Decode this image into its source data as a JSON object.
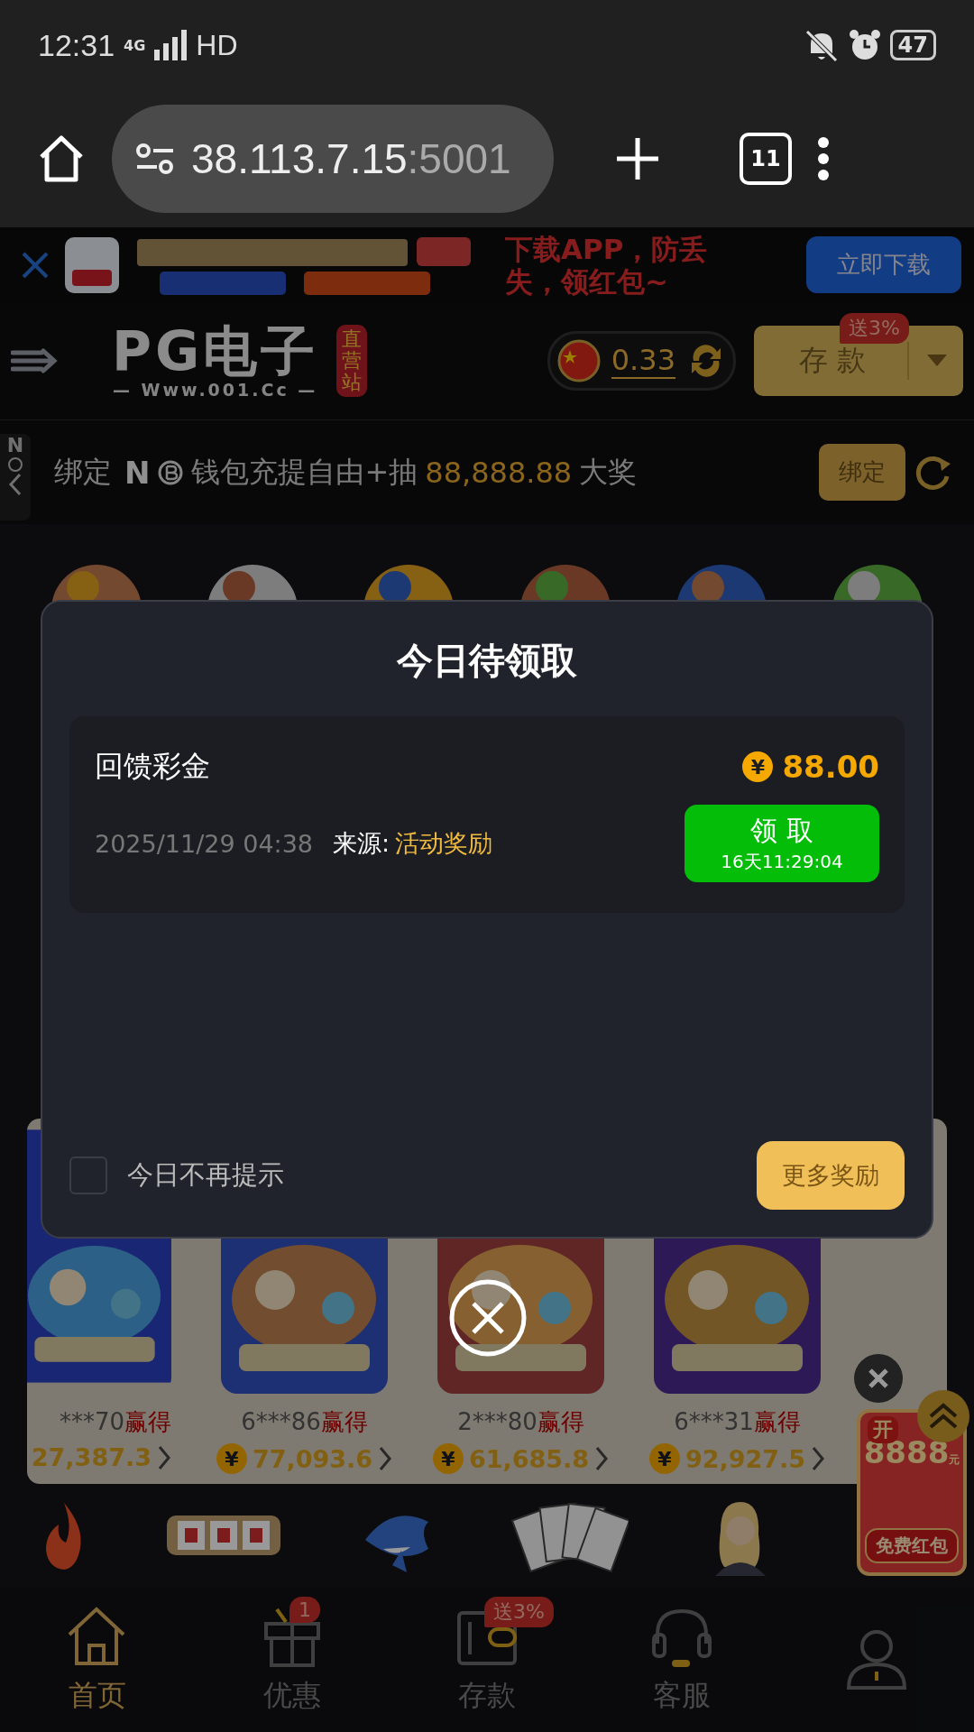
{
  "status_bar": {
    "time": "12:31",
    "network": "4G",
    "hd": "HD",
    "battery": "47"
  },
  "browser": {
    "url_host": "38.113.7.15",
    "url_port": ":5001",
    "tab_count": "11"
  },
  "download_banner": {
    "kind": "picture",
    "message": "下载APP，防丢失，领红包~",
    "button": "立即下载"
  },
  "header": {
    "logo_title": "PG电子",
    "logo_site": "— Www.001.Cc —",
    "logo_tag": "直营站",
    "balance": "0.33",
    "deposit_button": "存 款",
    "deposit_badge": "送3%"
  },
  "notice": {
    "side_tab": "N",
    "prefix": "绑定",
    "brand": "N",
    "text": "钱包充提自由+抽",
    "amount": "88,888.88",
    "suffix": "大奖",
    "button": "绑定"
  },
  "modal": {
    "title": "今日待领取",
    "rewards": [
      {
        "name": "回馈彩金",
        "currency": "¥",
        "amount": "88.00",
        "date": "2025/11/29 04:38",
        "source_label": "来源:",
        "source": "活动奖励",
        "claim_button": "领 取",
        "countdown": "16天11:29:04"
      }
    ],
    "dont_show_today": {
      "label": "今日不再提示",
      "checked": false
    },
    "more_button": "更多奖励"
  },
  "wins": [
    {
      "user": "***70",
      "verb": "赢得",
      "amount": "27,387.3"
    },
    {
      "user": "6***86",
      "verb": "赢得",
      "currency": "¥",
      "amount": "77,093.6"
    },
    {
      "user": "2***80",
      "verb": "赢得",
      "currency": "¥",
      "amount": "61,685.8"
    },
    {
      "user": "6***31",
      "verb": "赢得",
      "currency": "¥",
      "amount": "92,927.5"
    }
  ],
  "red_packet": {
    "corner": "开",
    "amount": "8888",
    "unit": "元",
    "button": "免费红包"
  },
  "bottom_nav": [
    {
      "label": "首页",
      "selected": true
    },
    {
      "label": "优惠",
      "selected": false,
      "badge": "1"
    },
    {
      "label": "存款",
      "selected": false,
      "badge": "送3%"
    },
    {
      "label": "客服",
      "selected": false
    },
    {
      "selected": false
    }
  ]
}
